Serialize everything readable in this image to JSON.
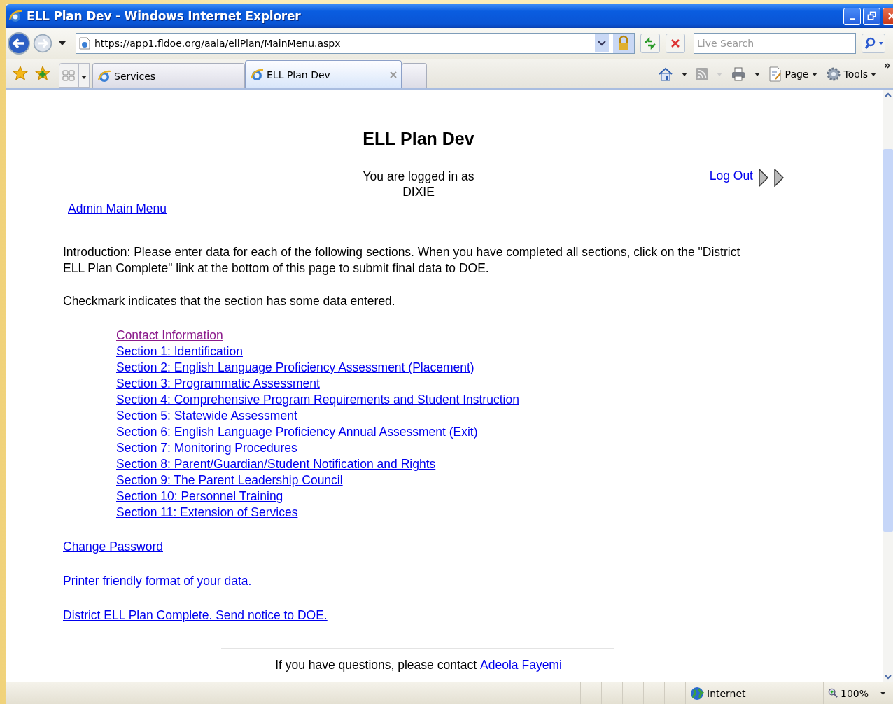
{
  "window": {
    "title": "ELL Plan Dev - Windows Internet Explorer"
  },
  "address_bar": {
    "url": "https://app1.fldoe.org/aala/ellPlan/MainMenu.aspx"
  },
  "search": {
    "placeholder": "Live Search"
  },
  "tabs": [
    {
      "label": "Services",
      "selected": false
    },
    {
      "label": "ELL Plan Dev",
      "selected": true
    }
  ],
  "command_bar": [
    "Page",
    "Tools"
  ],
  "page": {
    "heading": "ELL Plan Dev",
    "login_lines": [
      "You are logged in as",
      "DIXIE"
    ],
    "logout_link": "Log Out",
    "admin_link": "Admin Main Menu",
    "intro": "Introduction: Please enter data for each of the following sections. When you have completed all sections, click on the \"District ELL Plan Complete\" link at the bottom of this page to submit final data to DOE.",
    "note": "Checkmark indicates that the section has some data entered.",
    "sections": [
      {
        "label": "Contact Information",
        "visited": true
      },
      {
        "label": "Section 1: Identification",
        "visited": false
      },
      {
        "label": "Section 2: English Language Proficiency Assessment (Placement)",
        "visited": false
      },
      {
        "label": "Section 3: Programmatic Assessment",
        "visited": false
      },
      {
        "label": "Section 4: Comprehensive Program Requirements and Student Instruction",
        "visited": false
      },
      {
        "label": "Section 5: Statewide Assessment",
        "visited": false
      },
      {
        "label": "Section 6: English Language Proficiency Annual Assessment (Exit)",
        "visited": false
      },
      {
        "label": "Section 7: Monitoring Procedures",
        "visited": false
      },
      {
        "label": "Section 8: Parent/Guardian/Student Notification and Rights",
        "visited": false
      },
      {
        "label": "Section 9: The Parent Leadership Council",
        "visited": false
      },
      {
        "label": "Section 10: Personnel Training",
        "visited": false
      },
      {
        "label": "Section 11: Extension of Services",
        "visited": false
      }
    ],
    "links": [
      "Change Password",
      "Printer friendly format of your data.",
      "District ELL Plan Complete. Send notice to DOE."
    ],
    "footer_text": "If you have questions, please contact",
    "footer_link": "Adeola Fayemi"
  },
  "status_bar": {
    "zone": "Internet",
    "zoom": "100%"
  }
}
